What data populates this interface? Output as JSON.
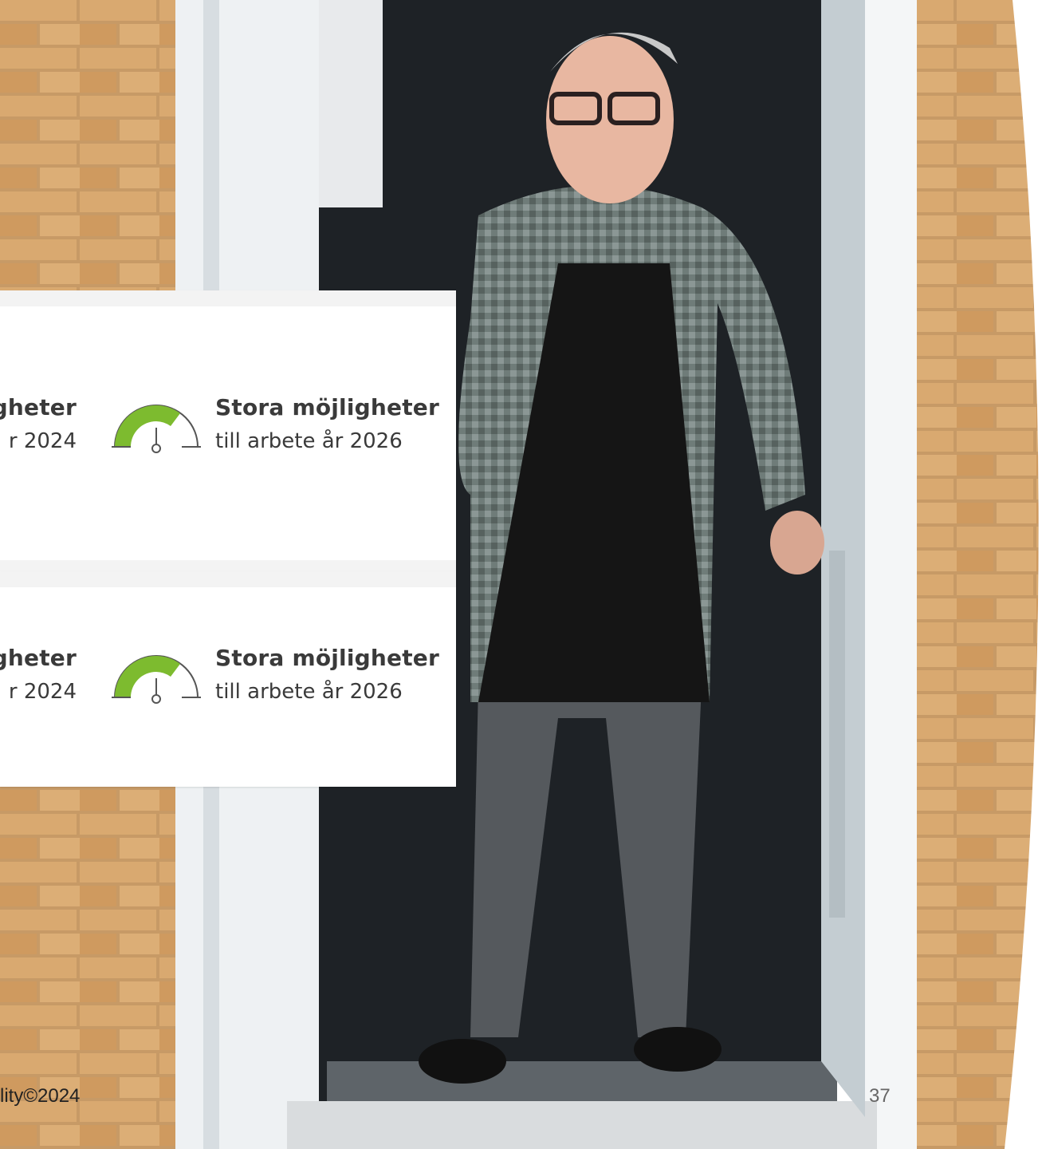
{
  "cards": [
    {
      "left_label_strong": "gheter",
      "left_label_sub": "r 2024",
      "right_label_strong": "Stora möjligheter",
      "right_label_sub": "till arbete år 2026",
      "gauge_level": "high"
    },
    {
      "left_label_strong": "gheter",
      "left_label_sub": "r 2024",
      "right_label_strong": "Stora möjligheter",
      "right_label_sub": "till arbete år 2026",
      "gauge_level": "high"
    }
  ],
  "footer": {
    "copyright": "lity©2024",
    "page_number": "37"
  },
  "colors": {
    "gauge_green": "#7dbb2f",
    "gauge_outline": "#555555",
    "text": "#3a3a3a"
  }
}
